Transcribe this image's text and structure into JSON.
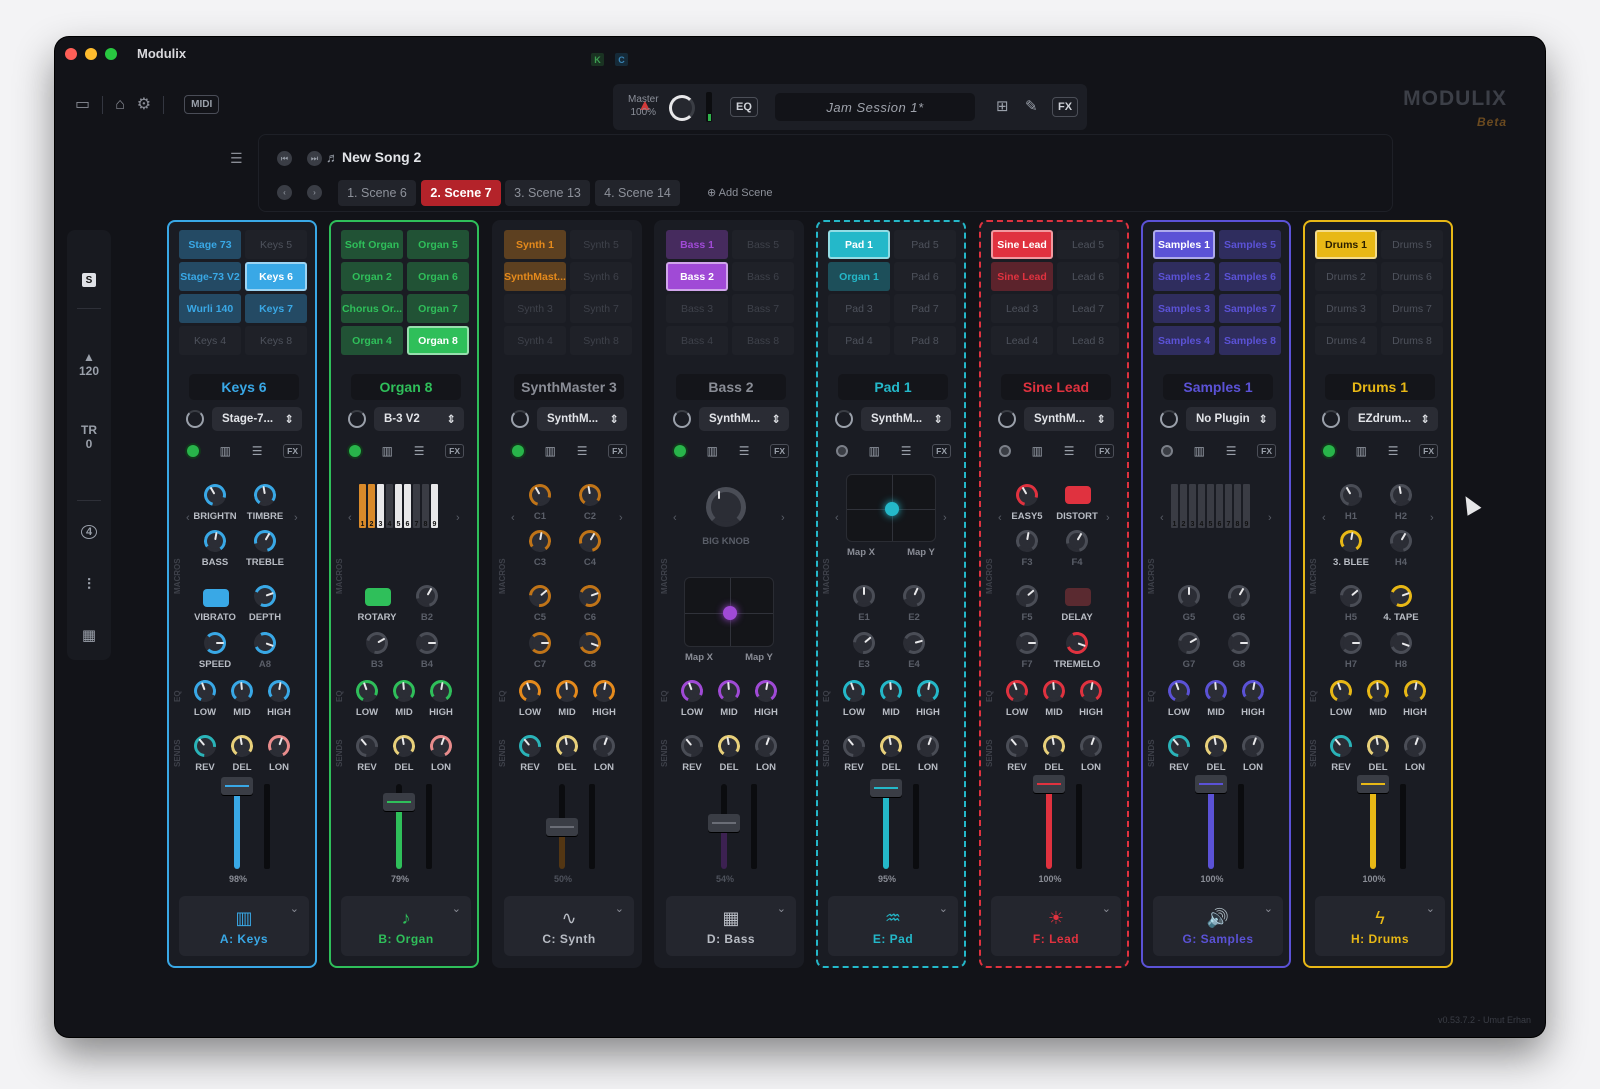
{
  "window": {
    "title": "Modulix"
  },
  "toolbar": {
    "midi": "MIDI",
    "k": "K",
    "c": "C",
    "master_label": "Master",
    "master_value": "100%",
    "eq": "EQ",
    "session": "Jam Session 1*",
    "fx": "FX",
    "brand": "MODULIX",
    "beta": "Beta"
  },
  "song": {
    "name": "New Song 2",
    "scenes": [
      "1. Scene 6",
      "2. Scene 7",
      "3. Scene 13",
      "4. Scene 14"
    ],
    "active_scene": 1,
    "add_scene": "Add Scene"
  },
  "sidebar": {
    "s": "S",
    "tempo": "120",
    "tr": "TR",
    "tr_value": "0",
    "circle_value": "4"
  },
  "channels": [
    {
      "id": "keys",
      "name": "Keys 6",
      "plugin": "Stage-7...",
      "color": "#39a8e6",
      "footer": "A: Keys",
      "fader": "98%",
      "clips": [
        "Stage 73",
        "Keys 5",
        "Stage-73 V2",
        "Keys 6",
        "Wurli 140",
        "Keys 7",
        "Keys 4",
        "Keys 8"
      ],
      "knobs": [
        "BRIGHTN",
        "TIMBRE",
        "BASS",
        "TREBLE",
        "VIBRATO",
        "DEPTH",
        "SPEED",
        "A8"
      ],
      "eq": [
        "LOW",
        "MID",
        "HIGH"
      ],
      "sends": [
        "REV",
        "DEL",
        "LON"
      ]
    },
    {
      "id": "organ",
      "name": "Organ 8",
      "plugin": "B-3 V2",
      "color": "#2fbf5a",
      "footer": "B: Organ",
      "fader": "79%",
      "clips": [
        "Soft Organ",
        "Organ 5",
        "Organ 2",
        "Organ 6",
        "Chorus Or...",
        "Organ 7",
        "Organ 4",
        "Organ 8"
      ],
      "knobs": [
        "ROTARY",
        "B2",
        "B3",
        "B4"
      ],
      "keys": [
        "1",
        "2",
        "3",
        "4",
        "5",
        "6",
        "7",
        "8",
        "9"
      ],
      "eq": [
        "LOW",
        "MID",
        "HIGH"
      ],
      "sends": [
        "REV",
        "DEL",
        "LON"
      ]
    },
    {
      "id": "synth",
      "name": "SynthMaster 3",
      "plugin": "SynthM...",
      "color": "#e58a1c",
      "footer": "C: Synth",
      "fader": "50%",
      "clips": [
        "Synth 1",
        "Synth 5",
        "SynthMast...",
        "Synth 6",
        "Synth 3",
        "Synth 7",
        "Synth 4",
        "Synth 8"
      ],
      "knobs": [
        "C1",
        "C2",
        "C3",
        "C4",
        "C5",
        "C6",
        "C7",
        "C8"
      ],
      "eq": [
        "LOW",
        "MID",
        "HIGH"
      ],
      "sends": [
        "REV",
        "DEL",
        "LON"
      ]
    },
    {
      "id": "bass",
      "name": "Bass 2",
      "plugin": "SynthM...",
      "color": "#a04ad6",
      "footer": "D: Bass",
      "fader": "54%",
      "clips": [
        "Bass 1",
        "Bass 5",
        "Bass 2",
        "Bass 6",
        "Bass 3",
        "Bass 7",
        "Bass 4",
        "Bass 8"
      ],
      "knobs": [
        "BIG KNOB"
      ],
      "xy": [
        "Map X",
        "Map Y"
      ],
      "eq": [
        "LOW",
        "MID",
        "HIGH"
      ],
      "sends": [
        "REV",
        "DEL",
        "LON"
      ]
    },
    {
      "id": "pad",
      "name": "Pad 1",
      "plugin": "SynthM...",
      "color": "#24b8c9",
      "footer": "E: Pad",
      "fader": "95%",
      "clips": [
        "Pad 1",
        "Pad 5",
        "Organ 1",
        "Pad 6",
        "Pad 3",
        "Pad 7",
        "Pad 4",
        "Pad 8"
      ],
      "knobs": [
        "E1",
        "E2",
        "E3",
        "E4"
      ],
      "xy": [
        "Map X",
        "Map Y"
      ],
      "eq": [
        "LOW",
        "MID",
        "HIGH"
      ],
      "sends": [
        "REV",
        "DEL",
        "LON"
      ]
    },
    {
      "id": "lead",
      "name": "Sine Lead",
      "plugin": "SynthM...",
      "color": "#e0323f",
      "footer": "F: Lead",
      "fader": "100%",
      "clips": [
        "Sine Lead",
        "Lead 5",
        "Sine Lead",
        "Lead 6",
        "Lead 3",
        "Lead 7",
        "Lead 4",
        "Lead 8"
      ],
      "knobs": [
        "EASY5",
        "DISTORT",
        "F3",
        "F4",
        "F5",
        "DELAY",
        "F7",
        "TREMELO"
      ],
      "eq": [
        "LOW",
        "MID",
        "HIGH"
      ],
      "sends": [
        "REV",
        "DEL",
        "LON"
      ]
    },
    {
      "id": "samples",
      "name": "Samples 1",
      "plugin": "No Plugin",
      "color": "#5b52d6",
      "footer": "G: Samples",
      "fader": "100%",
      "clips": [
        "Samples 1",
        "Samples 5",
        "Samples 2",
        "Samples 6",
        "Samples 3",
        "Samples 7",
        "Samples 4",
        "Samples 8"
      ],
      "knobs": [
        "G5",
        "G6",
        "G7",
        "G8"
      ],
      "keys": [
        "1",
        "2",
        "3",
        "4",
        "5",
        "6",
        "7",
        "8",
        "9"
      ],
      "eq": [
        "LOW",
        "MID",
        "HIGH"
      ],
      "sends": [
        "REV",
        "DEL",
        "LON"
      ]
    },
    {
      "id": "drums",
      "name": "Drums 1",
      "plugin": "EZdrum...",
      "color": "#e8b816",
      "footer": "H: Drums",
      "fader": "100%",
      "clips": [
        "Drums 1",
        "Drums 5",
        "Drums 2",
        "Drums 6",
        "Drums 3",
        "Drums 7",
        "Drums 4",
        "Drums 8"
      ],
      "knobs": [
        "H1",
        "H2",
        "3. BLEE",
        "H4",
        "H5",
        "4. TAPE",
        "H7",
        "H8"
      ],
      "eq": [
        "LOW",
        "MID",
        "HIGH"
      ],
      "sends": [
        "REV",
        "DEL",
        "LON"
      ]
    }
  ],
  "labels": {
    "macros": "MACROS",
    "eq": "EQ",
    "sends": "SENDS"
  },
  "version": "v0.53.7.2 - Umut Erhan"
}
